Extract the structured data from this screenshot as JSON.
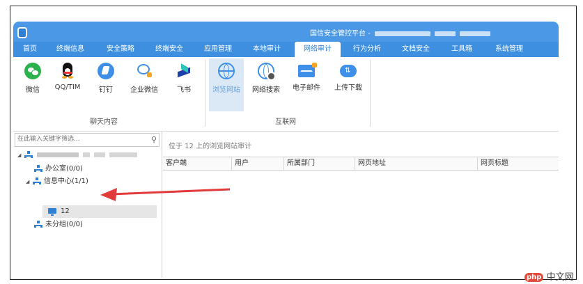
{
  "window": {
    "title": "国信安全管控平台 -"
  },
  "menu": {
    "tabs": [
      {
        "label": "首页"
      },
      {
        "label": "终端信息"
      },
      {
        "label": "安全策略"
      },
      {
        "label": "终端安全"
      },
      {
        "label": "应用管理"
      },
      {
        "label": "本地审计"
      },
      {
        "label": "网络审计"
      },
      {
        "label": "行为分析"
      },
      {
        "label": "文档安全"
      },
      {
        "label": "工具箱"
      },
      {
        "label": "系统管理"
      }
    ],
    "active": "网络审计"
  },
  "ribbon": {
    "chat": {
      "label": "聊天内容",
      "buttons": [
        {
          "label": "微信",
          "icon": "wechat-icon"
        },
        {
          "label": "QQ/TIM",
          "icon": "qq-icon"
        },
        {
          "label": "钉钉",
          "icon": "dingtalk-icon"
        },
        {
          "label": "企业微信",
          "icon": "wecom-icon"
        },
        {
          "label": "飞书",
          "icon": "feishu-icon"
        }
      ]
    },
    "internet": {
      "label": "互联网",
      "buttons": [
        {
          "label": "浏览网站",
          "icon": "globe-icon"
        },
        {
          "label": "网络搜索",
          "icon": "globe-search-icon"
        },
        {
          "label": "电子邮件",
          "icon": "mail-icon"
        },
        {
          "label": "上传下载",
          "icon": "cloud-transfer-icon"
        }
      ]
    }
  },
  "tree": {
    "search_placeholder": "在此输入关键字筛选...",
    "nodes": [
      {
        "label": "办公室(0/0)"
      },
      {
        "label": "信息中心(1/1)"
      },
      {
        "label": "12"
      },
      {
        "label": "未分组(0/0)"
      }
    ]
  },
  "main": {
    "location": "位于 12 上的浏览网站审计",
    "columns": [
      "客户端",
      "用户",
      "所属部门",
      "网页地址",
      "网页标题"
    ]
  },
  "watermark": {
    "logo": "php",
    "text": "中文网"
  },
  "colors": {
    "accent": "#4a98e6",
    "menubar": "#3f8fe0",
    "arrow": "#e03a3a"
  }
}
